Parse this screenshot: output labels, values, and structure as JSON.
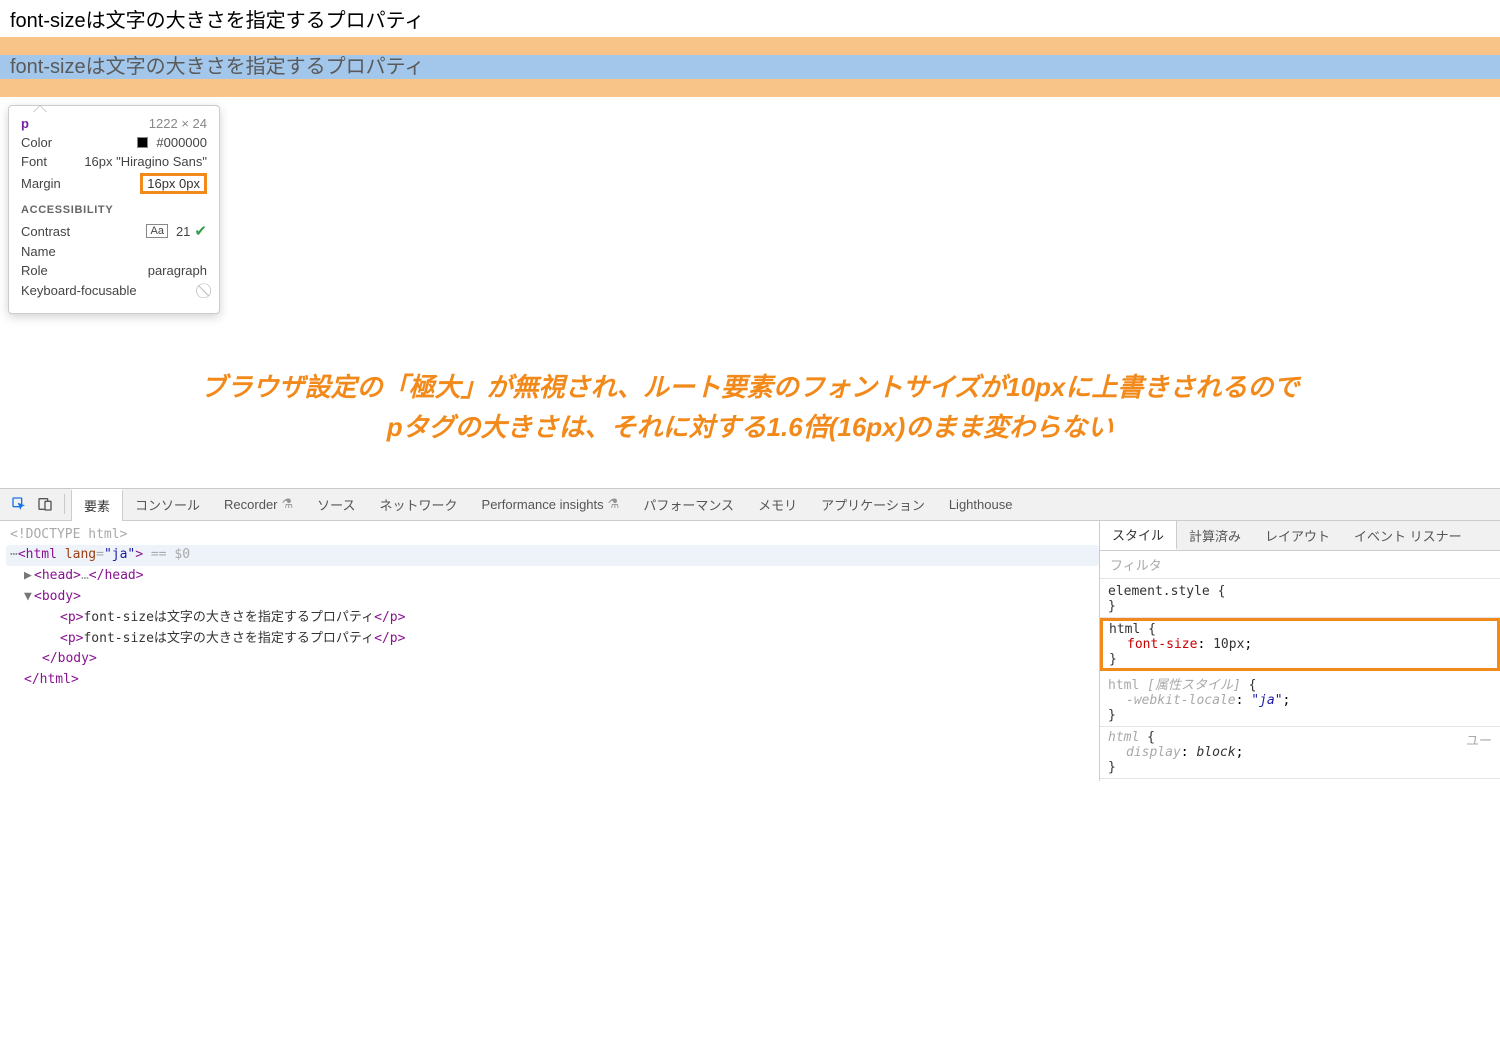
{
  "rendered": {
    "p1": "font-sizeは文字の大きさを指定するプロパティ",
    "p2": "font-sizeは文字の大きさを指定するプロパティ"
  },
  "tooltip": {
    "tag": "p",
    "dimensions": "1222 × 24",
    "rows": {
      "color_label": "Color",
      "color_value": "#000000",
      "font_label": "Font",
      "font_value": "16px \"Hiragino Sans\"",
      "margin_label": "Margin",
      "margin_value": "16px 0px"
    },
    "accessibility_header": "ACCESSIBILITY",
    "a11y": {
      "contrast_label": "Contrast",
      "contrast_aa": "Aa",
      "contrast_value": "21",
      "name_label": "Name",
      "role_label": "Role",
      "role_value": "paragraph",
      "focusable_label": "Keyboard-focusable"
    }
  },
  "annotation": {
    "line1": "ブラウザ設定の「極大」が無視され、ルート要素のフォントサイズが10pxに上書きされるので",
    "line2": "pタグの大きさは、それに対する1.6倍(16px)のまま変わらない"
  },
  "devtools": {
    "tabs": {
      "elements": "要素",
      "console": "コンソール",
      "recorder": "Recorder",
      "sources": "ソース",
      "network": "ネットワーク",
      "perf_insights": "Performance insights",
      "performance": "パフォーマンス",
      "memory": "メモリ",
      "application": "アプリケーション",
      "lighthouse": "Lighthouse"
    },
    "dom": {
      "doctype": "<!DOCTYPE html>",
      "html_open_pre": "<html ",
      "html_attr_name": "lang",
      "html_attr_val": "\"ja\"",
      "html_open_post": ">",
      "eq0": " == $0",
      "head": "<head>…</head>",
      "body_open": "<body>",
      "p_open": "<p>",
      "p_text": "font-sizeは文字の大きさを指定するプロパティ",
      "p_close": "</p>",
      "body_close": "</body>",
      "html_close": "</html>",
      "ellipsis": "…"
    },
    "styles": {
      "tabs": {
        "styles": "スタイル",
        "computed": "計算済み",
        "layout": "レイアウト",
        "listeners": "イベント リスナー"
      },
      "filter_placeholder": "フィルタ",
      "rule1_selector": "element.style",
      "rule2_selector": "html",
      "rule2_prop_name": "font-size",
      "rule2_prop_val": "10px",
      "rule3_selector": "html",
      "rule3_comment": "[属性スタイル]",
      "rule3_prop_name": "-webkit-locale",
      "rule3_prop_val": "\"ja\"",
      "rule4_selector": "html",
      "rule4_origin": "ユー",
      "rule4_prop_name": "display",
      "rule4_prop_val": "block",
      "brace_open": " {",
      "brace_close": "}",
      "colon_sp": ": ",
      "semicolon": ";"
    }
  }
}
